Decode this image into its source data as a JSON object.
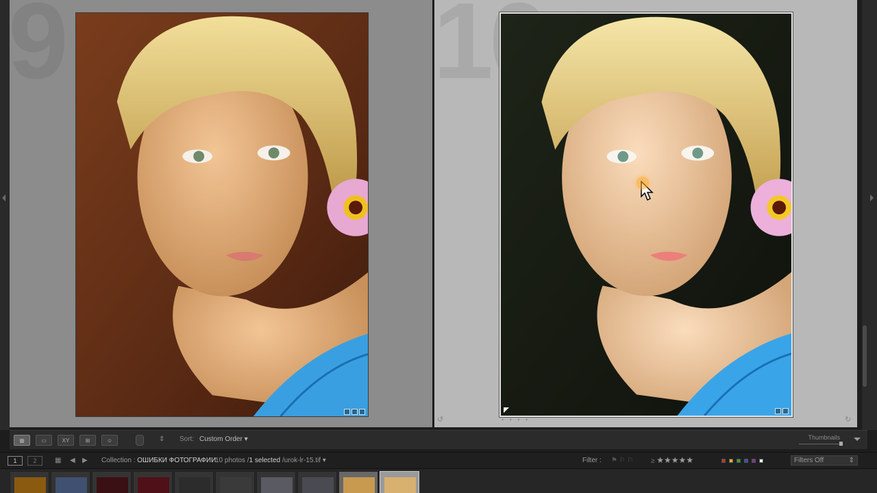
{
  "grid": {
    "cells": [
      {
        "index": "9",
        "badges": [
          "flag-icon",
          "crop-icon",
          "develop-icon"
        ]
      },
      {
        "index": "10",
        "badges": [
          "flag-icon",
          "develop-icon"
        ]
      }
    ],
    "cell_dots": "• • • •"
  },
  "toolbar": {
    "sort_label": "Sort:",
    "sort_value": "Custom Order",
    "sort_arrows": "⇕",
    "thumbnails_label": "Thumbnails",
    "view_buttons": [
      "grid-view-icon",
      "loupe-view-icon",
      "compare-view-icon",
      "survey-view-icon",
      "people-view-icon"
    ]
  },
  "filmstrip_header": {
    "monitor1": "1",
    "monitor2": "2",
    "collection_label": "Collection : ",
    "collection_name": "ОШИБКИ ФОТОГРАФИИ",
    "photo_count": "10 photos /",
    "selected": "1 selected",
    "filename": " /urok-lr-15.tif",
    "filter_label": "Filter :",
    "filters_value": "Filters Off",
    "stars": "★★★★★"
  },
  "colors": {
    "cell_bg": "#8c8c8c",
    "selected_cell_bg": "#b8b8b8",
    "panel_bg": "#2b2b2b",
    "swatches": [
      "#c83030",
      "#c8c030",
      "#30a030",
      "#3050c8",
      "#8030a0",
      "#ffffff"
    ]
  },
  "filmstrip": {
    "thumbs": [
      {
        "tone": "#8a5a10"
      },
      {
        "tone": "#405070"
      },
      {
        "tone": "#3a1014"
      },
      {
        "tone": "#501018"
      },
      {
        "tone": "#2c2c2c"
      },
      {
        "tone": "#3a3a3a"
      },
      {
        "tone": "#5a5a62"
      },
      {
        "tone": "#4a4a52"
      },
      {
        "tone": "#c89a50"
      },
      {
        "tone": "#d8b070"
      }
    ]
  }
}
